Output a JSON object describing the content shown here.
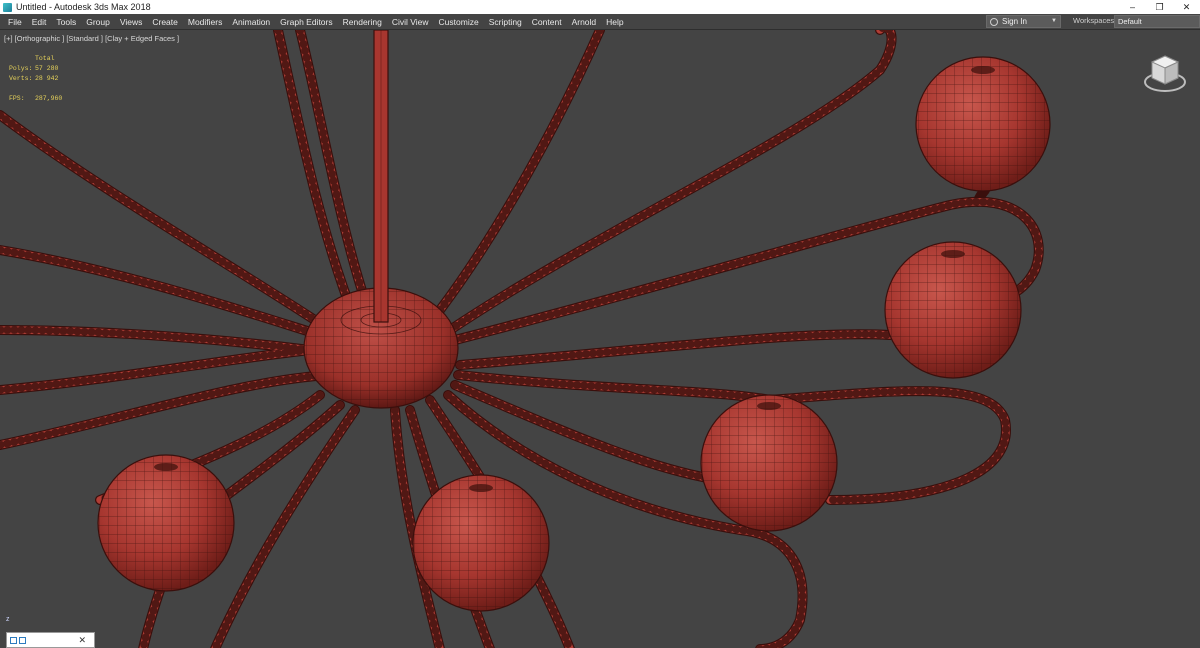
{
  "window": {
    "title": "Untitled - Autodesk 3ds Max 2018",
    "minimize_glyph": "–",
    "restore_glyph": "❐",
    "close_glyph": "✕"
  },
  "menubar": {
    "items": [
      "File",
      "Edit",
      "Tools",
      "Group",
      "Views",
      "Create",
      "Modifiers",
      "Animation",
      "Graph Editors",
      "Rendering",
      "Civil View",
      "Customize",
      "Scripting",
      "Content",
      "Arnold",
      "Help"
    ],
    "sign_in_label": "Sign In",
    "workspaces_label": "Workspaces:",
    "workspaces_value": "Default"
  },
  "viewport": {
    "label": "[+] [Orthographic ] [Standard ] [Clay + Edged Faces ]",
    "stats": {
      "total_label": "Total",
      "polys_label": "Polys:",
      "polys_value": "57 280",
      "verts_label": "Verts:",
      "verts_value": "28 942",
      "fps_label": "FPS:",
      "fps_value": "287,960"
    },
    "axis_label": "z"
  },
  "bottom_widget": {
    "close_glyph": "✕"
  },
  "colors": {
    "viewport_bg": "#444444",
    "clay_red": "#b8423a",
    "wire_dark": "#3a0f0c",
    "stats_yellow": "#e6d25a"
  },
  "icons": [
    "app-icon",
    "user-icon",
    "chevron-down-icon",
    "viewcube-icon",
    "axis-tripod-icon",
    "close-icon"
  ]
}
